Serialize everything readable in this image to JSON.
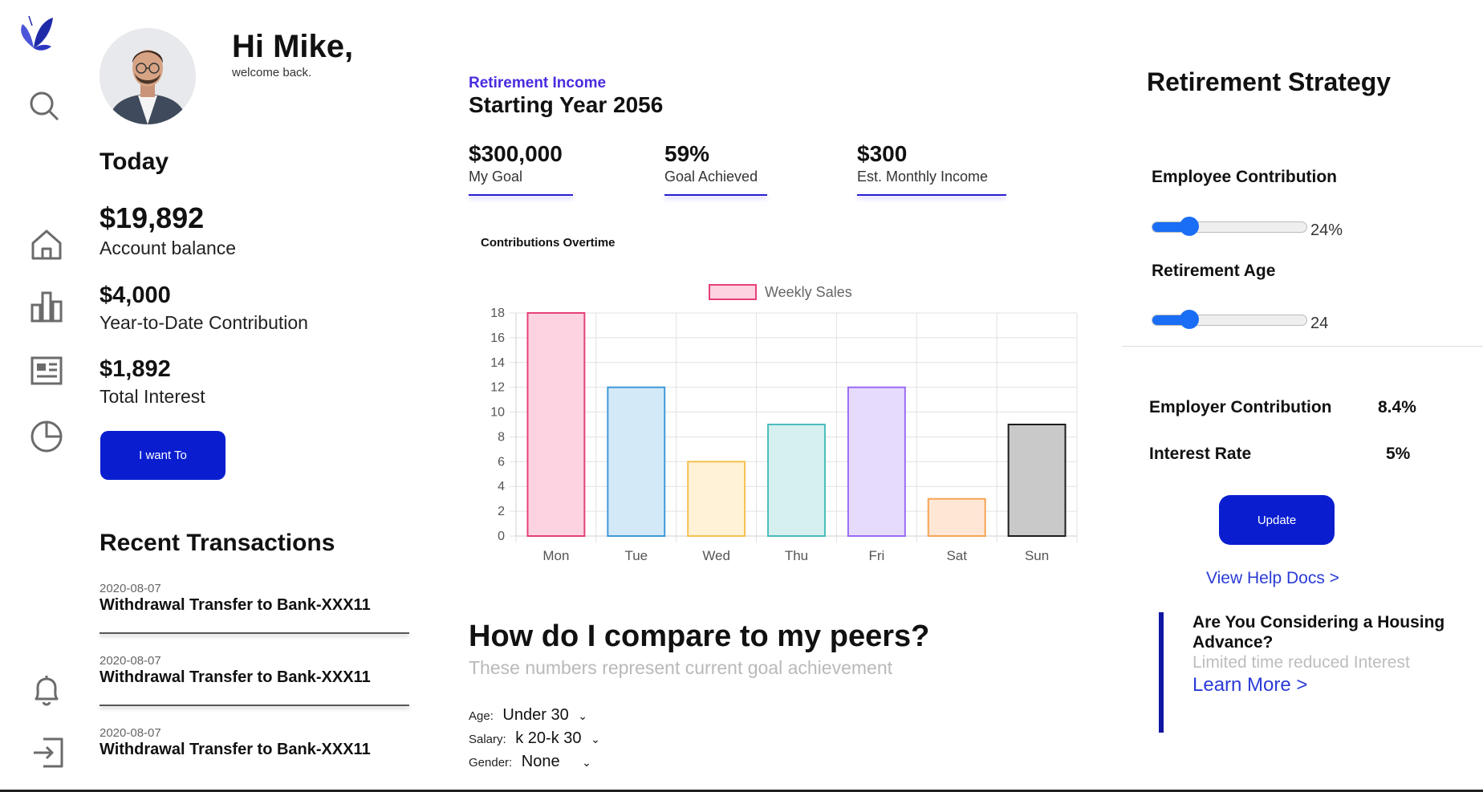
{
  "header": {
    "greeting": "Hi Mike,",
    "welcome": "welcome back."
  },
  "today": {
    "title": "Today",
    "balance": "$19,892",
    "balance_label": "Account balance",
    "ytd": "$4,000",
    "ytd_label": "Year-to-Date Contribution",
    "interest": "$1,892",
    "interest_label": "Total Interest",
    "cta": "I want To"
  },
  "transactions": {
    "title": "Recent Transactions",
    "items": [
      {
        "date": "2020-08-07",
        "desc": "Withdrawal Transfer to Bank-XXX11"
      },
      {
        "date": "2020-08-07",
        "desc": "Withdrawal Transfer to Bank-XXX11"
      },
      {
        "date": "2020-08-07",
        "desc": "Withdrawal Transfer to Bank-XXX11"
      }
    ]
  },
  "retirement": {
    "label": "Retirement Income",
    "title": "Starting Year 2056",
    "stats": [
      {
        "value": "$300,000",
        "label": "My Goal"
      },
      {
        "value": "59%",
        "label": "Goal Achieved"
      },
      {
        "value": "$300",
        "label": "Est. Monthly Income"
      }
    ]
  },
  "chart_title": "Contributions Overtime",
  "chart_data": {
    "type": "bar",
    "categories": [
      "Mon",
      "Tue",
      "Wed",
      "Thu",
      "Fri",
      "Sat",
      "Sun"
    ],
    "series": [
      {
        "name": "Weekly Sales",
        "values": [
          18,
          12,
          6,
          9,
          12,
          3,
          9
        ]
      }
    ],
    "ylim": [
      0,
      18
    ],
    "yticks": [
      "0",
      "2",
      "4",
      "6",
      "8",
      "10",
      "12",
      "14",
      "16",
      "18"
    ],
    "grid": true,
    "legend": "top-center",
    "fills": [
      "#fdd3e2",
      "#d4e9f8",
      "#fff2d6",
      "#d6f0ef",
      "#e7dbfd",
      "#ffe7d6",
      "#c9c9c9"
    ],
    "strokes": [
      "#e6407a",
      "#3e9ad8",
      "#f5c150",
      "#4bbdbb",
      "#9a6bf2",
      "#f5a452",
      "#1c1c1c"
    ],
    "legend_fill": "#fdd3e2",
    "legend_stroke": "#e6407a"
  },
  "peers": {
    "title": "How do I compare to my peers?",
    "subtitle": "These numbers represent current goal achievement",
    "filters": [
      {
        "label": "Age:",
        "value": "Under 30"
      },
      {
        "label": "Salary:",
        "value": "k 20-k 30"
      },
      {
        "label": "Gender:",
        "value": "None"
      }
    ]
  },
  "strategy": {
    "title": "Retirement Strategy",
    "employee_label": "Employee Contribution",
    "employee_value": "24%",
    "employee_fraction": 0.24,
    "age_label": "Retirement Age",
    "age_value": "24",
    "age_fraction": 0.24,
    "employer_label": "Employer Contribution",
    "employer_value": "8.4%",
    "interest_label": "Interest Rate",
    "interest_value": "5%",
    "update": "Update",
    "help": "View Help Docs >"
  },
  "promo": {
    "title": "Are You Considering a Housing Advance?",
    "subtitle": "Limited time reduced Interest",
    "link": "Learn More >"
  },
  "colors": {
    "primary": "#0a1ed0",
    "accent_text": "#4a2be0",
    "link": "#2a3bd6",
    "slider": "#1a6ef5"
  },
  "icons": [
    "butterfly-logo",
    "search-icon",
    "home-icon",
    "bar-chart-icon",
    "news-icon",
    "pie-chart-icon",
    "bell-icon",
    "logout-icon"
  ]
}
